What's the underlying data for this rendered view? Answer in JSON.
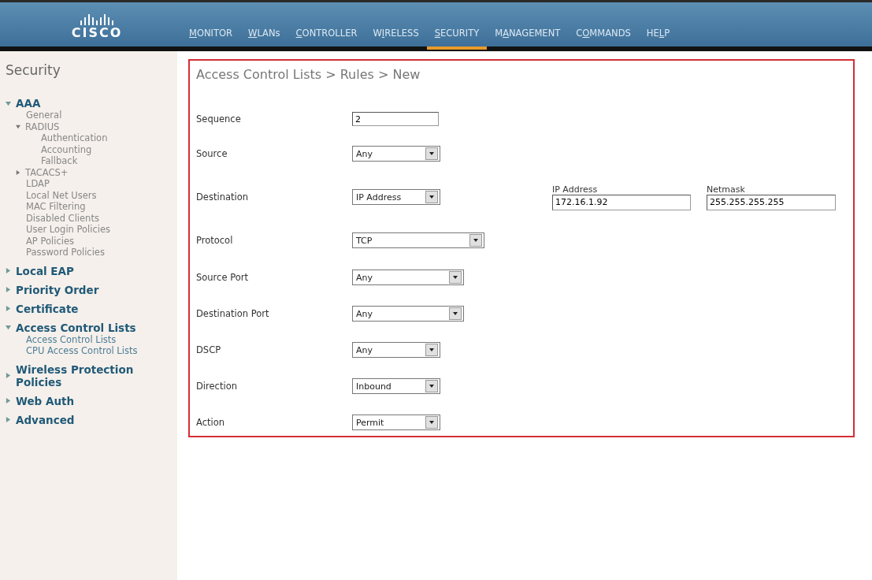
{
  "header": {
    "logo": "CISCO",
    "nav": [
      {
        "parts": [
          {
            "text": "M",
            "kind": "access_key"
          },
          {
            "text": "ONITOR",
            "kind": "plain"
          }
        ],
        "selected": false
      },
      {
        "parts": [
          {
            "text": "W",
            "kind": "access_key"
          },
          {
            "text": "LANs",
            "kind": "plain"
          }
        ],
        "selected": false
      },
      {
        "parts": [
          {
            "text": "C",
            "kind": "access_key"
          },
          {
            "text": "ONTROLLER",
            "kind": "plain"
          }
        ],
        "selected": false
      },
      {
        "parts": [
          {
            "text": "W",
            "kind": "plain"
          },
          {
            "text": "I",
            "kind": "access_key"
          },
          {
            "text": "RELESS",
            "kind": "plain"
          }
        ],
        "selected": false
      },
      {
        "parts": [
          {
            "text": "S",
            "kind": "access_key"
          },
          {
            "text": "ECURITY",
            "kind": "plain"
          }
        ],
        "selected": true
      },
      {
        "parts": [
          {
            "text": "M",
            "kind": "plain"
          },
          {
            "text": "A",
            "kind": "access_key"
          },
          {
            "text": "NAGEMENT",
            "kind": "plain"
          }
        ],
        "selected": false
      },
      {
        "parts": [
          {
            "text": "C",
            "kind": "plain"
          },
          {
            "text": "O",
            "kind": "access_key"
          },
          {
            "text": "MMANDS",
            "kind": "plain"
          }
        ],
        "selected": false
      },
      {
        "parts": [
          {
            "text": "HE",
            "kind": "plain"
          },
          {
            "text": "L",
            "kind": "access_key"
          },
          {
            "text": "P",
            "kind": "plain"
          }
        ],
        "selected": false
      }
    ]
  },
  "sidebar": {
    "title": "Security",
    "items": [
      {
        "label": "AAA",
        "expanded": true,
        "children": [
          {
            "label": "General"
          },
          {
            "label": "RADIUS",
            "expanded": true,
            "children": [
              {
                "label": "Authentication"
              },
              {
                "label": "Accounting"
              },
              {
                "label": "Fallback"
              }
            ]
          },
          {
            "label": "TACACS+",
            "expanded": false
          },
          {
            "label": "LDAP"
          },
          {
            "label": "Local Net Users"
          },
          {
            "label": "MAC Filtering"
          },
          {
            "label": "Disabled Clients"
          },
          {
            "label": "User Login Policies"
          },
          {
            "label": "AP Policies"
          },
          {
            "label": "Password Policies"
          }
        ]
      },
      {
        "label": "Local EAP",
        "expanded": false
      },
      {
        "label": "Priority Order",
        "expanded": false
      },
      {
        "label": "Certificate",
        "expanded": false
      },
      {
        "label": "Access Control Lists",
        "expanded": true,
        "children": [
          {
            "label": "Access Control Lists"
          },
          {
            "label": "CPU Access Control Lists"
          }
        ]
      },
      {
        "label": "Wireless Protection Policies",
        "expanded": false
      },
      {
        "label": "Web Auth",
        "expanded": false
      },
      {
        "label": "Advanced",
        "expanded": false
      }
    ]
  },
  "main": {
    "breadcrumb": "Access Control Lists > Rules > New",
    "fields": [
      {
        "label": "Sequence",
        "kind": "text",
        "value": "2"
      },
      {
        "label": "Source",
        "kind": "select",
        "value": "Any"
      },
      {
        "label": "Destination",
        "kind": "select",
        "value": "IP Address",
        "extra": [
          {
            "label": "IP Address",
            "value": "172.16.1.92"
          },
          {
            "label": "Netmask",
            "value": "255.255.255.255"
          }
        ]
      },
      {
        "label": "Protocol",
        "kind": "select",
        "value": "TCP"
      },
      {
        "label": "Source Port",
        "kind": "select",
        "value": "Any"
      },
      {
        "label": "Destination Port",
        "kind": "select",
        "value": "Any"
      },
      {
        "label": "DSCP",
        "kind": "select",
        "value": "Any"
      },
      {
        "label": "Direction",
        "kind": "select",
        "value": "Inbound"
      },
      {
        "label": "Action",
        "kind": "select",
        "value": "Permit"
      }
    ]
  }
}
